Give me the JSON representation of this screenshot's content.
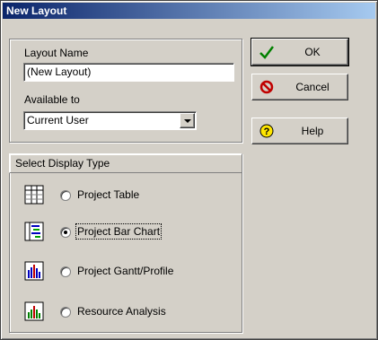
{
  "window": {
    "title": "New Layout"
  },
  "layout_name": {
    "label": "Layout Name",
    "value": "(New Layout)"
  },
  "available_to": {
    "label": "Available to",
    "value": "Current User"
  },
  "display_type": {
    "header": "Select Display Type",
    "options": [
      {
        "label": "Project Table",
        "icon": "table-icon",
        "selected": false
      },
      {
        "label": "Project Bar Chart",
        "icon": "bar-chart-icon",
        "selected": true
      },
      {
        "label": "Project Gantt/Profile",
        "icon": "gantt-profile-icon",
        "selected": false
      },
      {
        "label": "Resource Analysis",
        "icon": "resource-analysis-icon",
        "selected": false
      }
    ]
  },
  "buttons": {
    "ok": "OK",
    "cancel": "Cancel",
    "help": "Help"
  },
  "colors": {
    "title_start": "#0a246a",
    "title_end": "#a6caf0",
    "face": "#d4d0c8"
  }
}
